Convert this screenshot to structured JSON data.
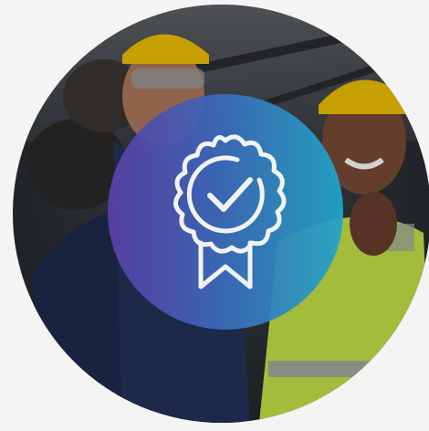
{
  "image": {
    "subject": "industrial-workers-photo",
    "icon": "certification-badge-icon",
    "colors": {
      "page_background": "#f4f4f4",
      "gradient_start": "#5b3fa6",
      "gradient_mid": "#3d67b8",
      "gradient_end": "#21a5c8",
      "icon_stroke": "#ffffff",
      "hard_hat": "#f2c200",
      "safety_vest": "#c9e64a"
    }
  }
}
